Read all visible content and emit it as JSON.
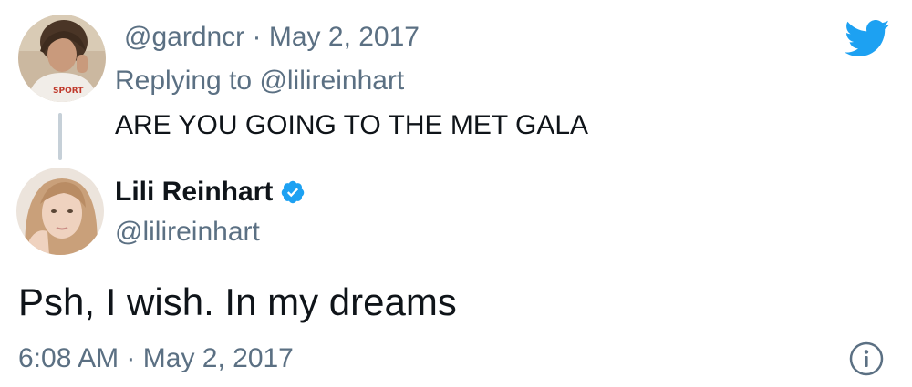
{
  "reply_tweet": {
    "handle": "@gardncr",
    "separator": "·",
    "date": "May 2, 2017",
    "replying_to_prefix": "Replying to",
    "replying_to_handle": "@lilireinhart",
    "text": "ARE YOU GOING TO THE MET GALA"
  },
  "main_tweet": {
    "display_name": "Lili Reinhart",
    "verified": true,
    "handle": "@lilireinhart",
    "text": "Psh, I wish. In my dreams",
    "time": "6:08 AM",
    "separator": "·",
    "date": "May 2, 2017"
  },
  "icons": {
    "brand": "twitter-bird-icon",
    "verified": "verified-badge-icon",
    "info": "info-icon"
  },
  "colors": {
    "twitter_blue": "#1da1f2",
    "secondary_text": "#5b7083",
    "primary_text": "#0f1419",
    "thread_line": "#c6d0d8"
  }
}
